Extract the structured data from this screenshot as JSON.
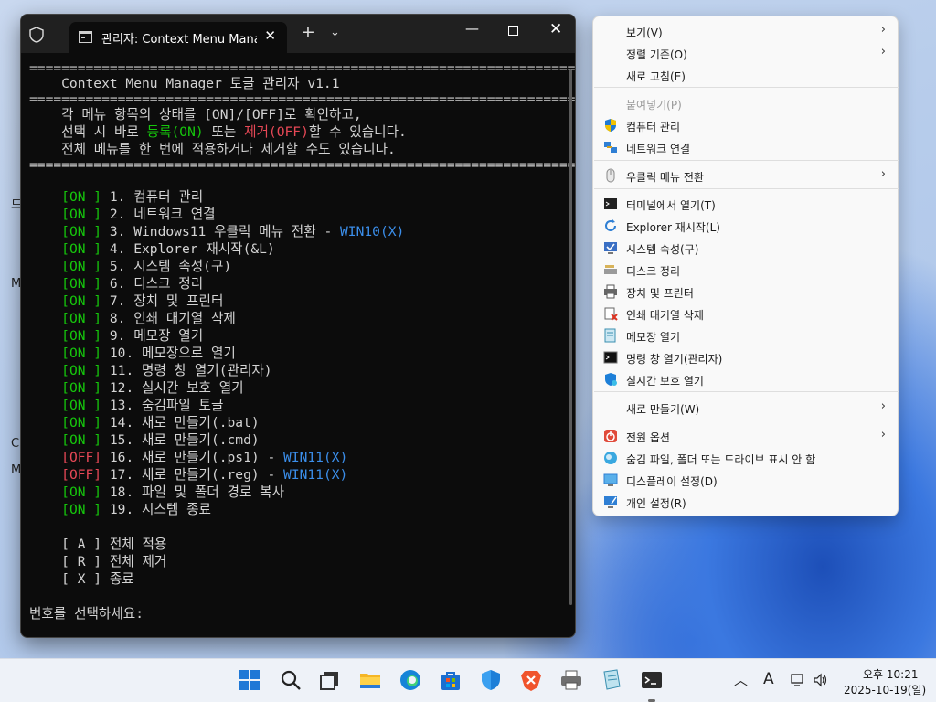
{
  "desktop": {
    "side_labels": [
      "드",
      "M",
      "C",
      "M"
    ]
  },
  "terminal": {
    "tab_title": "관리자:  Context Menu Manag",
    "tab_close": "✕",
    "new_tab": "+",
    "dropdown": "⌄",
    "minimize": "—",
    "close": "✕",
    "separator": "====================================================================",
    "title": "    Context Menu Manager 토글 관리자 v1.1",
    "desc1": "    각 메뉴 항목의 상태를 [ON]/[OFF]로 확인하고,",
    "desc2_a": "    선택 시 바로 ",
    "desc2_b": "등록(ON)",
    "desc2_c": " 또는 ",
    "desc2_d": "제거(OFF)",
    "desc2_e": "할 수 있습니다.",
    "desc3": "    전체 메뉴를 한 번에 적용하거나 제거할 수도 있습니다.",
    "items": [
      {
        "status": "[ON ]",
        "label": " 1. 컴퓨터 관리",
        "tag": ""
      },
      {
        "status": "[ON ]",
        "label": " 2. 네트워크 연결",
        "tag": ""
      },
      {
        "status": "[ON ]",
        "label": " 3. Windows11 우클릭 메뉴 전환 - ",
        "tag": "WIN10(X)"
      },
      {
        "status": "[ON ]",
        "label": " 4. Explorer 재시작(&L)",
        "tag": ""
      },
      {
        "status": "[ON ]",
        "label": " 5. 시스템 속성(구)",
        "tag": ""
      },
      {
        "status": "[ON ]",
        "label": " 6. 디스크 정리",
        "tag": ""
      },
      {
        "status": "[ON ]",
        "label": " 7. 장치 및 프린터",
        "tag": ""
      },
      {
        "status": "[ON ]",
        "label": " 8. 인쇄 대기열 삭제",
        "tag": ""
      },
      {
        "status": "[ON ]",
        "label": " 9. 메모장 열기",
        "tag": ""
      },
      {
        "status": "[ON ]",
        "label": " 10. 메모장으로 열기",
        "tag": ""
      },
      {
        "status": "[ON ]",
        "label": " 11. 명령 창 열기(관리자)",
        "tag": ""
      },
      {
        "status": "[ON ]",
        "label": " 12. 실시간 보호 열기",
        "tag": ""
      },
      {
        "status": "[ON ]",
        "label": " 13. 숨김파일 토글",
        "tag": ""
      },
      {
        "status": "[ON ]",
        "label": " 14. 새로 만들기(.bat)",
        "tag": ""
      },
      {
        "status": "[ON ]",
        "label": " 15. 새로 만들기(.cmd)",
        "tag": ""
      },
      {
        "status": "[OFF]",
        "label": " 16. 새로 만들기(.ps1) - ",
        "tag": "WIN11(X)"
      },
      {
        "status": "[OFF]",
        "label": " 17. 새로 만들기(.reg) - ",
        "tag": "WIN11(X)"
      },
      {
        "status": "[ON ]",
        "label": " 18. 파일 및 폴더 경로 복사",
        "tag": ""
      },
      {
        "status": "[ON ]",
        "label": " 19. 시스템 종료",
        "tag": ""
      }
    ],
    "actions": [
      "    [ A ] 전체 적용",
      "    [ R ] 전체 제거",
      "    [ X ] 종료"
    ],
    "prompt": "번호를 선택하세요:"
  },
  "context_menu": {
    "items": [
      {
        "label": "보기(V)",
        "icon": "",
        "submenu": true
      },
      {
        "label": "정렬 기준(O)",
        "icon": "",
        "submenu": true
      },
      {
        "label": "새로 고침(E)",
        "icon": "",
        "submenu": false
      },
      {
        "label": "붙여넣기(P)",
        "icon": "",
        "submenu": false,
        "disabled": true
      },
      {
        "label": "컴퓨터 관리",
        "icon": "shield-uac-icon",
        "submenu": false
      },
      {
        "label": "네트워크 연결",
        "icon": "network-icon",
        "submenu": false
      },
      {
        "label": "우클릭 메뉴 전환",
        "icon": "mouse-icon",
        "submenu": true
      },
      {
        "label": "터미널에서 열기(T)",
        "icon": "terminal-icon",
        "submenu": false
      },
      {
        "label": "Explorer 재시작(L)",
        "icon": "refresh-icon",
        "submenu": false
      },
      {
        "label": "시스템 속성(구)",
        "icon": "system-icon",
        "submenu": false
      },
      {
        "label": "디스크 정리",
        "icon": "disk-cleanup-icon",
        "submenu": false
      },
      {
        "label": "장치 및 프린터",
        "icon": "printer-icon",
        "submenu": false
      },
      {
        "label": "인쇄 대기열 삭제",
        "icon": "print-queue-delete-icon",
        "submenu": false
      },
      {
        "label": "메모장 열기",
        "icon": "notepad-icon",
        "submenu": false
      },
      {
        "label": "명령 창 열기(관리자)",
        "icon": "cmd-icon",
        "submenu": false
      },
      {
        "label": "실시간 보호 열기",
        "icon": "defender-icon",
        "submenu": false
      },
      {
        "label": "새로 만들기(W)",
        "icon": "",
        "submenu": true
      },
      {
        "label": "전원 옵션",
        "icon": "power-icon",
        "submenu": true
      },
      {
        "label": "숨김 파일, 폴더 또는 드라이브 표시 안 함",
        "icon": "hidden-files-icon",
        "submenu": false
      },
      {
        "label": "디스플레이 설정(D)",
        "icon": "display-icon",
        "submenu": false
      },
      {
        "label": "개인 설정(R)",
        "icon": "personalize-icon",
        "submenu": false
      }
    ]
  },
  "taskbar": {
    "time": "오후 10:21",
    "date": "2025-10-19(일)",
    "ime": "A",
    "chevron": "︿",
    "apps": [
      "start-icon",
      "search-icon",
      "task-view-icon",
      "file-explorer-icon",
      "edge-icon",
      "store-icon",
      "defender-icon",
      "brave-icon",
      "printer-icon",
      "notepad-icon",
      "terminal-icon"
    ]
  }
}
